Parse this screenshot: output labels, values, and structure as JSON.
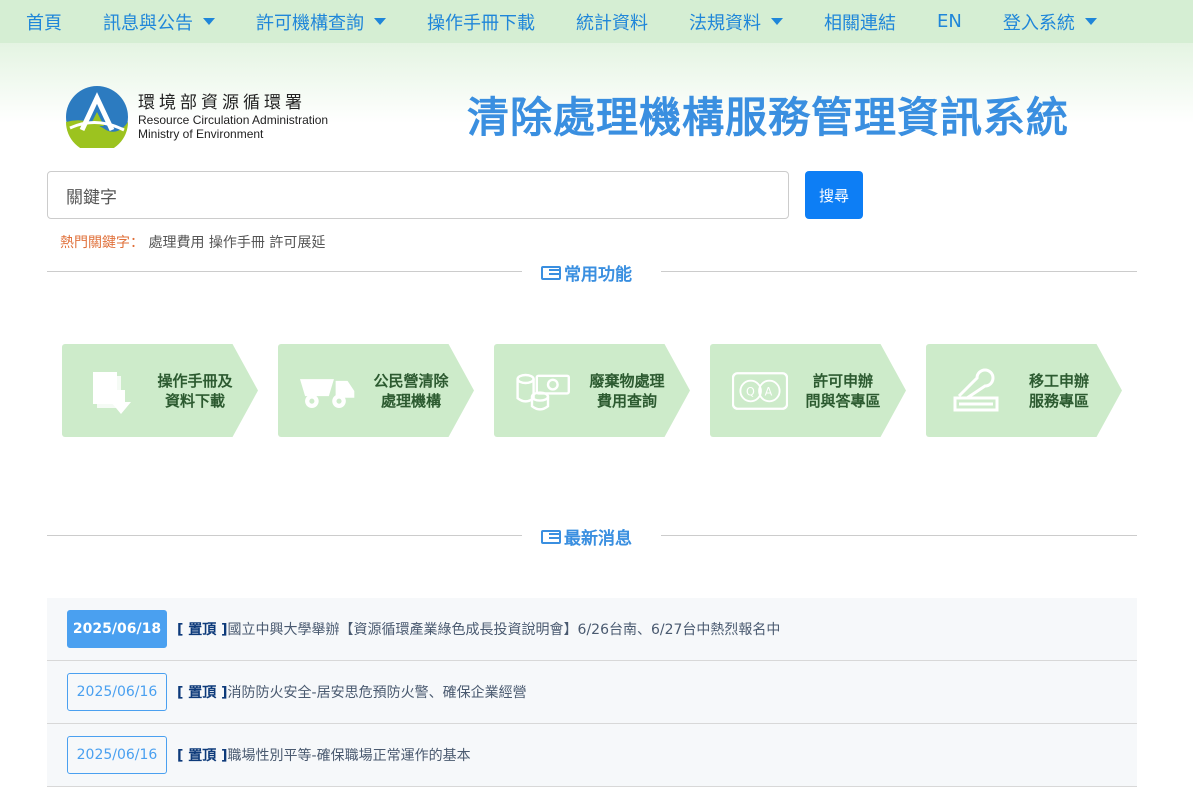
{
  "nav": {
    "items": [
      {
        "label": "首頁",
        "dropdown": false
      },
      {
        "label": "訊息與公告",
        "dropdown": true
      },
      {
        "label": "許可機構查詢",
        "dropdown": true
      },
      {
        "label": "操作手冊下載",
        "dropdown": false
      },
      {
        "label": "統計資料",
        "dropdown": false
      },
      {
        "label": "法規資料",
        "dropdown": true
      },
      {
        "label": "相關連結",
        "dropdown": false
      },
      {
        "label": "EN",
        "dropdown": false
      },
      {
        "label": "登入系統",
        "dropdown": true
      }
    ]
  },
  "logo": {
    "zh": "環境部資源循環署",
    "en1": "Resource Circulation Administration",
    "en2": "Ministry of Environment"
  },
  "title": "清除處理機構服務管理資訊系統",
  "search": {
    "placeholder": "關鍵字",
    "button": "搜尋"
  },
  "hot": {
    "label": "熱門關鍵字：",
    "keywords": [
      "處理費用",
      "操作手冊",
      "許可展延"
    ]
  },
  "sections": {
    "functions": "常用功能",
    "news": "最新消息"
  },
  "tiles": [
    {
      "line1": "操作手冊及",
      "line2": "資料下載",
      "icon": "document-download-icon"
    },
    {
      "line1": "公民營清除",
      "line2": "處理機構",
      "icon": "dump-truck-icon"
    },
    {
      "line1": "廢棄物處理",
      "line2": "費用查詢",
      "icon": "coins-money-icon"
    },
    {
      "line1": "許可申辦",
      "line2": "問與答專區",
      "icon": "qa-bubble-icon"
    },
    {
      "line1": "移工申辦",
      "line2": "服務專區",
      "icon": "wrench-icon"
    }
  ],
  "news": [
    {
      "date": "2025/06/18",
      "pin": "[ 置頂 ]",
      "text": "國立中興大學舉辦【資源循環產業綠色成長投資說明會】6/26台南、6/27台中熱烈報名中"
    },
    {
      "date": "2025/06/16",
      "pin": "[ 置頂 ]",
      "text": "消防防火安全-居安思危預防火警、確保企業經營"
    },
    {
      "date": "2025/06/16",
      "pin": "[ 置頂 ]",
      "text": "職場性別平等-確保職場正常運作的基本"
    }
  ]
}
